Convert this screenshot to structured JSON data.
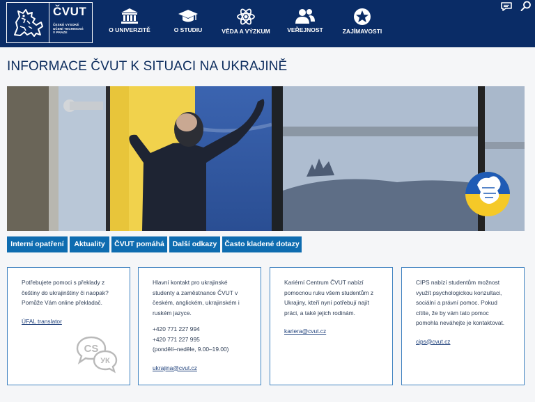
{
  "header": {
    "logo": {
      "name": "ČVUT",
      "subtitle": [
        "ČESKÉ VYSOKÉ",
        "UČENÍ TECHNICKÉ",
        "V PRAZE"
      ]
    },
    "nav": [
      {
        "label": "O UNIVERZITĚ",
        "icon": "university-building-icon"
      },
      {
        "label": "O STUDIU",
        "icon": "graduation-cap-icon"
      },
      {
        "label": "VĚDA A VÝZKUM",
        "icon": "atom-icon"
      },
      {
        "label": "VEŘEJNOST",
        "icon": "people-icon"
      },
      {
        "label": "ZAJÍMAVOSTI",
        "icon": "star-badge-icon"
      }
    ],
    "tools": [
      "chat-icon",
      "search-icon"
    ]
  },
  "page": {
    "title": "INFORMACE ČVUT K SITUACI NA UKRAJINĚ"
  },
  "tabs": [
    {
      "label": "Interní opatření"
    },
    {
      "label": "Aktuality"
    },
    {
      "label": "ČVUT pomáhá"
    },
    {
      "label": "Další odkazy"
    },
    {
      "label": "Často kladené dotazy"
    }
  ],
  "cards": [
    {
      "lines": [
        "Potřebujete pomoci s překlady z",
        "češtiny do ukrajinštiny či naopak?",
        "Pomůže Vám online překladač."
      ],
      "link": "ÚFAL translator",
      "icon": {
        "name": "translate-bubbles-icon",
        "text_1": "CS",
        "text_2": "УК"
      }
    },
    {
      "lines": [
        "Hlavní kontakt pro ukrajinské",
        "studenty a zaměstnance ČVUT v",
        "českém, anglickém, ukrajinském i",
        "ruském jazyce."
      ],
      "phones": [
        "+420 771 227 994",
        "+420 771 227 995",
        "(pondělí–neděle, 9.00–19.00)"
      ],
      "link": "ukrajina@cvut.cz"
    },
    {
      "lines": [
        "Kariérní Centrum ČVUT nabízí",
        "pomocnou ruku všem studentům z",
        "Ukrajiny, kteří nyní potřebují najít",
        "práci, a také jejich rodinám."
      ],
      "link": "kariera@cvut.cz"
    },
    {
      "lines": [
        "CIPS nabízí studentům možnost",
        "využít psychologickou konzultaci,",
        "sociální a právní pomoc. Pokud",
        "cítíte, že by vám tato pomoc",
        "pomohla neváhejte je kontaktovat."
      ],
      "link": "cips@cvut.cz"
    }
  ],
  "colors": {
    "header_bg": "#0a2c66",
    "tab_bg": "#0e6cb0",
    "card_border": "#3f82c0",
    "ukraine_blue": "#1f5bb5",
    "ukraine_yellow": "#f5c928"
  }
}
